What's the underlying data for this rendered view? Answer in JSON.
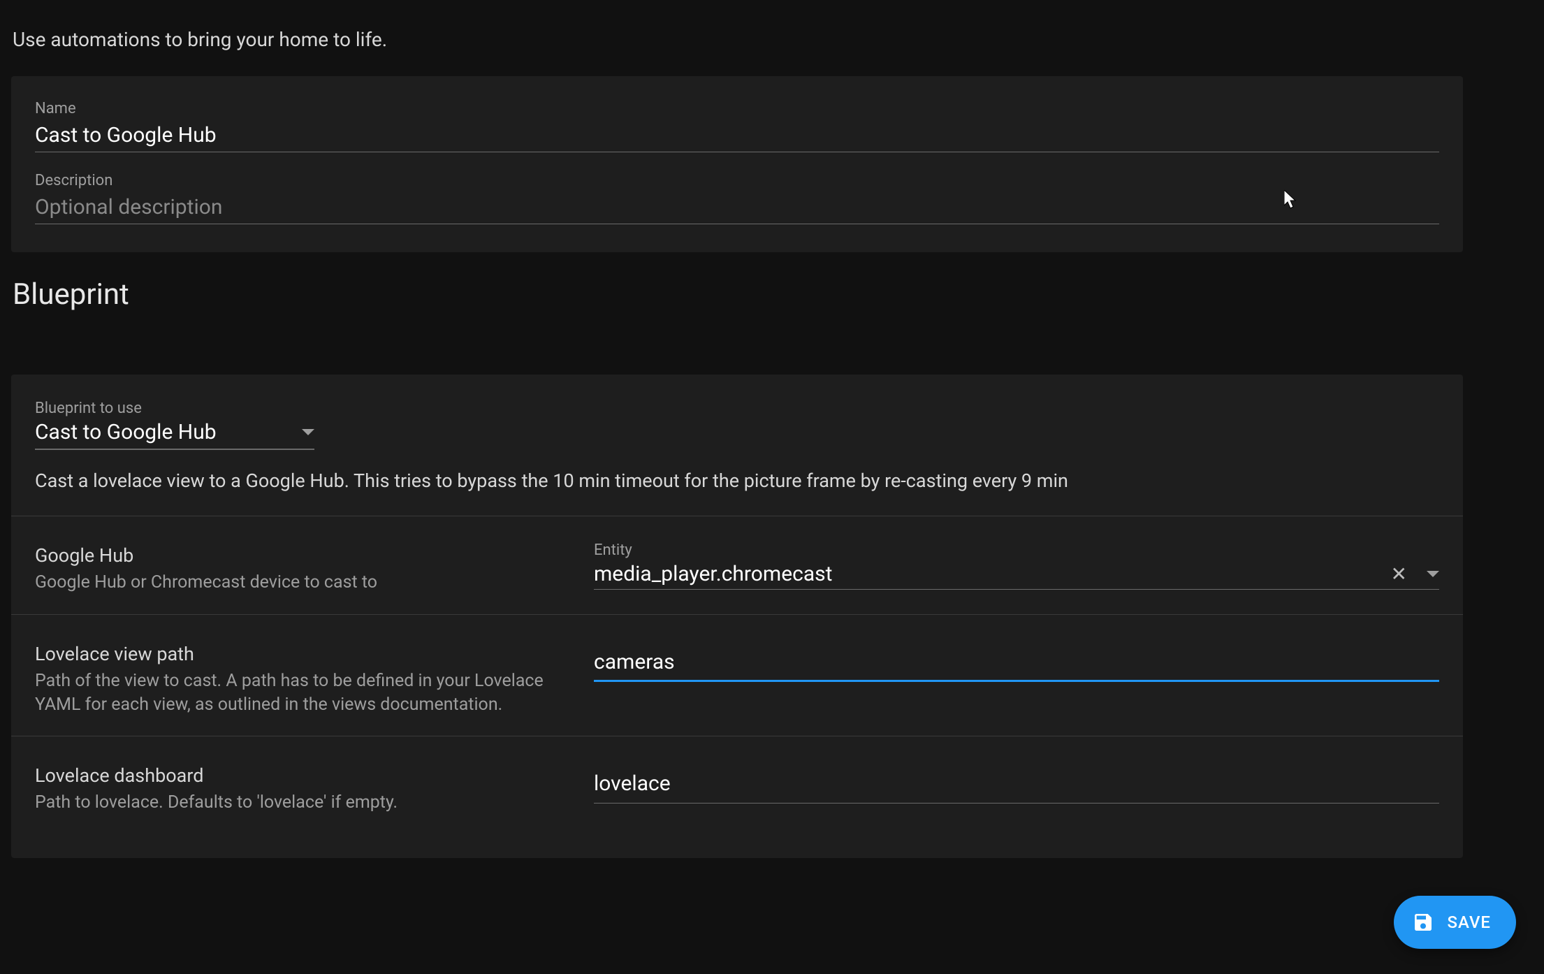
{
  "intro": "Use automations to bring your home to life.",
  "form": {
    "name_label": "Name",
    "name_value": "Cast to Google Hub",
    "description_label": "Description",
    "description_placeholder": "Optional description",
    "description_value": ""
  },
  "section_title": "Blueprint",
  "blueprint": {
    "select_label": "Blueprint to use",
    "select_value": "Cast to Google Hub",
    "description": "Cast a lovelace view to a Google Hub. This tries to bypass the 10 min timeout for the picture frame by re-casting every 9 min",
    "params": {
      "google_hub": {
        "title": "Google Hub",
        "help": "Google Hub or Chromecast device to cast to",
        "entity_label": "Entity",
        "entity_value": "media_player.chromecast"
      },
      "view_path": {
        "title": "Lovelace view path",
        "help": "Path of the view to cast. A path has to be defined in your Lovelace YAML for each view, as outlined in the views documentation.",
        "value": "cameras"
      },
      "dashboard": {
        "title": "Lovelace dashboard",
        "help": "Path to lovelace. Defaults to 'lovelace' if empty.",
        "value": "lovelace"
      }
    }
  },
  "save_label": "SAVE"
}
